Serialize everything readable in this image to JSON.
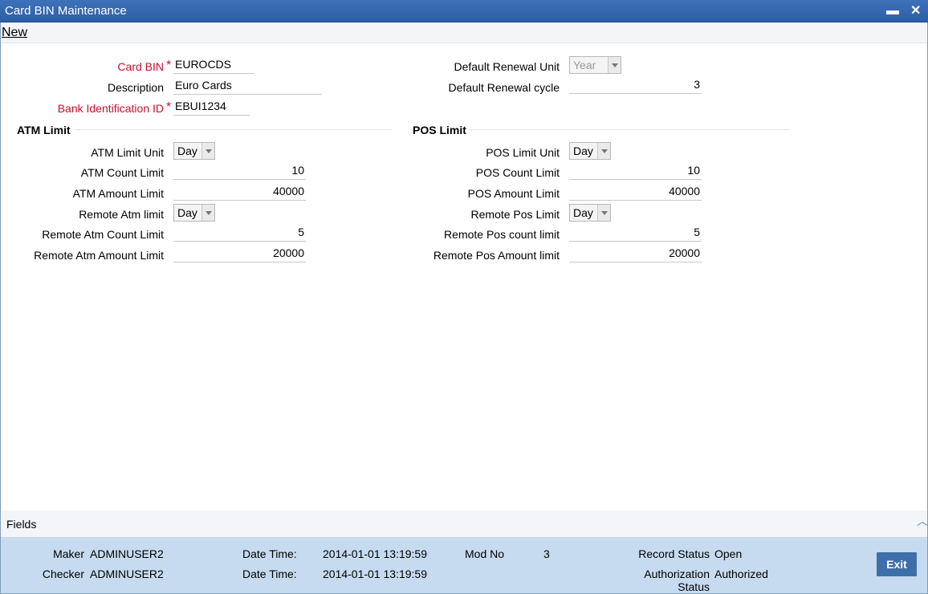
{
  "window": {
    "title": "Card BIN Maintenance",
    "min_glyph": "▬",
    "close_glyph": "✕"
  },
  "toolbar": {
    "new_label": "New"
  },
  "form": {
    "card_bin": {
      "label": "Card BIN",
      "value": "EUROCDS"
    },
    "description": {
      "label": "Description",
      "value": "Euro Cards"
    },
    "bank_id": {
      "label": "Bank Identification ID",
      "value": "EBUI1234"
    },
    "renewal_unit": {
      "label": "Default Renewal Unit",
      "value": "Year"
    },
    "renewal_cycle": {
      "label": "Default Renewal cycle",
      "value": "3"
    },
    "required_mark": "*"
  },
  "atm": {
    "heading": "ATM Limit",
    "limit_unit": {
      "label": "ATM Limit Unit",
      "value": "Day"
    },
    "count_limit": {
      "label": "ATM Count Limit",
      "value": "10"
    },
    "amount_limit": {
      "label": "ATM Amount Limit",
      "value": "40000"
    },
    "remote_limit": {
      "label": "Remote Atm limit",
      "value": "Day"
    },
    "remote_count": {
      "label": "Remote Atm Count Limit",
      "value": "5"
    },
    "remote_amount": {
      "label": "Remote Atm Amount Limit",
      "value": "20000"
    }
  },
  "pos": {
    "heading": "POS Limit",
    "limit_unit": {
      "label": "POS Limit Unit",
      "value": "Day"
    },
    "count_limit": {
      "label": "POS Count Limit",
      "value": "10"
    },
    "amount_limit": {
      "label": "POS Amount Limit",
      "value": "40000"
    },
    "remote_limit": {
      "label": "Remote Pos Limit",
      "value": "Day"
    },
    "remote_count": {
      "label": "Remote Pos count limit",
      "value": "5"
    },
    "remote_amount": {
      "label": "Remote Pos Amount limit",
      "value": "20000"
    }
  },
  "fields_bar": {
    "label": "Fields",
    "chevron": "︿"
  },
  "footer": {
    "maker_label": "Maker",
    "maker_value": "ADMINUSER2",
    "checker_label": "Checker",
    "checker_value": "ADMINUSER2",
    "datetime_label": "Date Time:",
    "maker_datetime": "2014-01-01 13:19:59",
    "checker_datetime": "2014-01-01 13:19:59",
    "modno_label": "Mod No",
    "modno_value": "3",
    "record_status_label": "Record Status",
    "record_status_value": "Open",
    "auth_status_label_1": "Authorization",
    "auth_status_label_2": "Status",
    "auth_status_value": "Authorized",
    "exit_label": "Exit"
  }
}
